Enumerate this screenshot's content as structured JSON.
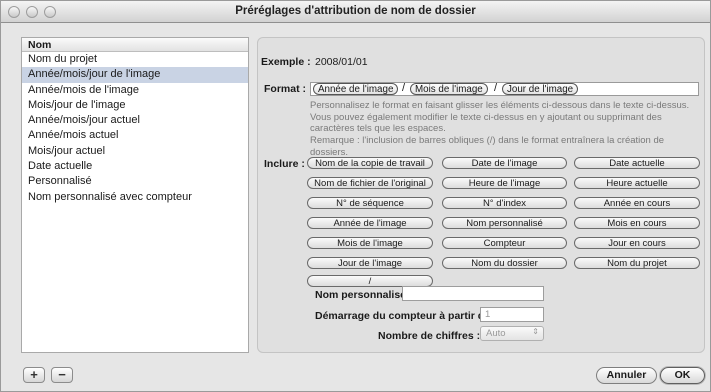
{
  "window": {
    "title": "Préréglages d'attribution de nom de dossier"
  },
  "list": {
    "header": "Nom",
    "items": [
      {
        "label": "Nom du projet"
      },
      {
        "label": "Année/mois/jour de l'image",
        "selected": true
      },
      {
        "label": "Année/mois de l'image"
      },
      {
        "label": "Mois/jour de l'image"
      },
      {
        "label": "Année/mois/jour actuel"
      },
      {
        "label": "Année/mois actuel"
      },
      {
        "label": "Mois/jour actuel"
      },
      {
        "label": "Date actuelle"
      },
      {
        "label": "Personnalisé"
      },
      {
        "label": "Nom personnalisé avec compteur"
      }
    ]
  },
  "bottom_buttons": {
    "add": "+",
    "remove": "−"
  },
  "example": {
    "label": "Exemple :",
    "value": "2008/01/01"
  },
  "format": {
    "label": "Format :",
    "tokens": [
      "Année de l'image",
      "Mois de l'image",
      "Jour de l'image"
    ],
    "separator": "/",
    "help1": "Personnalisez le format en faisant glisser les éléments ci-dessous dans le texte ci-dessus. Vous pouvez également modifier le texte ci-dessus en y ajoutant ou supprimant des caractères tels que les espaces.",
    "help2": "Remarque : l'inclusion de barres obliques (/) dans le format entraînera la création de dossiers."
  },
  "include": {
    "label": "Inclure :",
    "rows": [
      [
        "Nom de la copie de travail",
        "Date de l'image",
        "Date actuelle"
      ],
      [
        "Nom de fichier de l'original",
        "Heure de l'image",
        "Heure actuelle"
      ],
      [
        "N° de séquence",
        "N° d'index",
        "Année en cours"
      ],
      [
        "Année de l'image",
        "Nom personnalisé",
        "Mois en cours"
      ],
      [
        "Mois de l'image",
        "Compteur",
        "Jour en cours"
      ],
      [
        "Jour de l'image",
        "Nom du dossier",
        "Nom du projet"
      ],
      [
        "/"
      ]
    ]
  },
  "custom_name": {
    "label": "Nom personnalisé :",
    "value": ""
  },
  "counter_start": {
    "label": "Démarrage du compteur à partir de :",
    "value": "1"
  },
  "digits": {
    "label": "Nombre de chiffres :",
    "value": "Auto"
  },
  "actions": {
    "cancel": "Annuler",
    "ok": "OK"
  }
}
